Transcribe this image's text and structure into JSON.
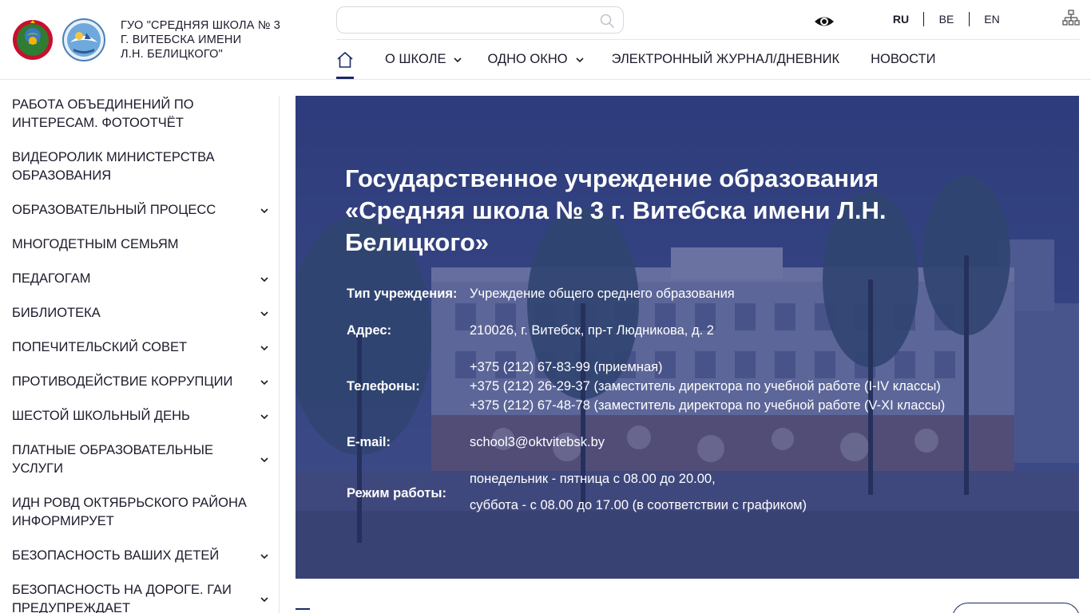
{
  "header": {
    "org_name_lines": [
      "ГУО \"СРЕДНЯЯ ШКОЛА № 3",
      "Г. ВИТЕБСКА ИМЕНИ",
      "Л.Н. БЕЛИЦКОГО\""
    ],
    "search": {
      "value": "",
      "placeholder": ""
    },
    "languages": [
      {
        "label": "RU",
        "active": true
      },
      {
        "label": "BE",
        "active": false
      },
      {
        "label": "EN",
        "active": false
      }
    ],
    "icons": [
      "belarus-emblem-icon",
      "school-logo-icon",
      "search-icon",
      "eye-icon",
      "sitemap-icon",
      "home-icon"
    ]
  },
  "nav": {
    "items": [
      {
        "label": "О ШКОЛЕ",
        "has_dropdown": true
      },
      {
        "label": "ОДНО ОКНО",
        "has_dropdown": true
      },
      {
        "label": "ЭЛЕКТРОННЫЙ ЖУРНАЛ/ДНЕВНИК",
        "has_dropdown": false
      },
      {
        "label": "НОВОСТИ",
        "has_dropdown": false
      }
    ]
  },
  "sidebar": {
    "items": [
      {
        "label": "РАБОТА ОБЪЕДИНЕНИЙ ПО ИНТЕРЕСАМ. ФОТООТЧЁТ",
        "has_dropdown": false
      },
      {
        "label": "ВИДЕОРОЛИК МИНИСТЕРСТВА ОБРАЗОВАНИЯ",
        "has_dropdown": false
      },
      {
        "label": "ОБРАЗОВАТЕЛЬНЫЙ ПРОЦЕСС",
        "has_dropdown": true
      },
      {
        "label": "МНОГОДЕТНЫМ СЕМЬЯМ",
        "has_dropdown": false
      },
      {
        "label": "ПЕДАГОГАМ",
        "has_dropdown": true
      },
      {
        "label": "БИБЛИОТЕКА",
        "has_dropdown": true
      },
      {
        "label": "ПОПЕЧИТЕЛЬСКИЙ СОВЕТ",
        "has_dropdown": true
      },
      {
        "label": "ПРОТИВОДЕЙСТВИЕ КОРРУПЦИИ",
        "has_dropdown": true
      },
      {
        "label": "ШЕСТОЙ ШКОЛЬНЫЙ ДЕНЬ",
        "has_dropdown": true
      },
      {
        "label": "ПЛАТНЫЕ ОБРАЗОВАТЕЛЬНЫЕ УСЛУГИ",
        "has_dropdown": true
      },
      {
        "label": "ИДН РОВД ОКТЯБРЬСКОГО РАЙОНА ИНФОРМИРУЕТ",
        "has_dropdown": false
      },
      {
        "label": "БЕЗОПАСНОСТЬ ВАШИХ ДЕТЕЙ",
        "has_dropdown": true
      },
      {
        "label": "БЕЗОПАСНОСТЬ НА ДОРОГЕ. ГАИ ПРЕДУПРЕЖДАЕТ",
        "has_dropdown": true
      }
    ]
  },
  "hero": {
    "title": "Государственное учреждение образования «Средняя школа № 3 г. Витебска имени Л.Н. Белицкого»",
    "info": {
      "type_label": "Тип учреждения:",
      "type_value": "Учреждение общего среднего образования",
      "address_label": "Адрес:",
      "address_value": "210026, г. Витебск, пр-т Людникова, д. 2",
      "phones_label": "Телефоны:",
      "phones": [
        "+375 (212) 67-83-99 (приемная)",
        "+375 (212) 26-29-37 (заместитель директора по учебной работе (I-IV классы)",
        "+375 (212) 67-48-78 (заместитель директора по учебной работе (V-XI классы)"
      ],
      "email_label": "E-mail:",
      "email_value": "school3@oktvitebsk.by",
      "hours_label": "Режим работы:",
      "hours": [
        "понедельник - пятница с 08.00 до 20.00,",
        "суббота - с 08.00 до 17.00 (в соответствии с графиком)"
      ]
    }
  },
  "colors": {
    "brand_navy": "#1b2a63",
    "overlay": "#23306e",
    "text_dark": "#1b1b2b",
    "divider": "#e3e6ee"
  }
}
